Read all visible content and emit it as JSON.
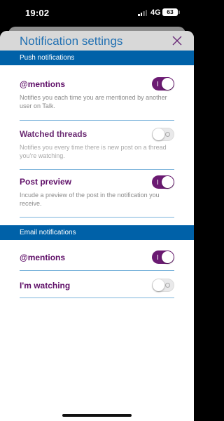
{
  "status_bar": {
    "time": "19:02",
    "network": "4G",
    "battery": "63"
  },
  "sheet": {
    "title": "Notification settings"
  },
  "sections": {
    "push": {
      "label": "Push notifications",
      "items": [
        {
          "label": "@mentions",
          "description": "Notifies you each time you are mentioned by another user on Talk.",
          "enabled": true
        },
        {
          "label": "Watched threads",
          "description": "Notifies you every time there is new post on a thread you're watching.",
          "enabled": false
        },
        {
          "label": "Post preview",
          "description": "Incude a preview of the post in the notification you receive.",
          "enabled": true
        }
      ]
    },
    "email": {
      "label": "Email notifications",
      "items": [
        {
          "label": "@mentions",
          "enabled": true
        },
        {
          "label": "I'm watching",
          "enabled": false
        }
      ]
    }
  },
  "colors": {
    "accent": "#0061a8",
    "title": "#1f6fb2",
    "label": "#5f0f68",
    "toggle_on": "#6b1a72"
  },
  "icons": {
    "close": "close-icon"
  }
}
